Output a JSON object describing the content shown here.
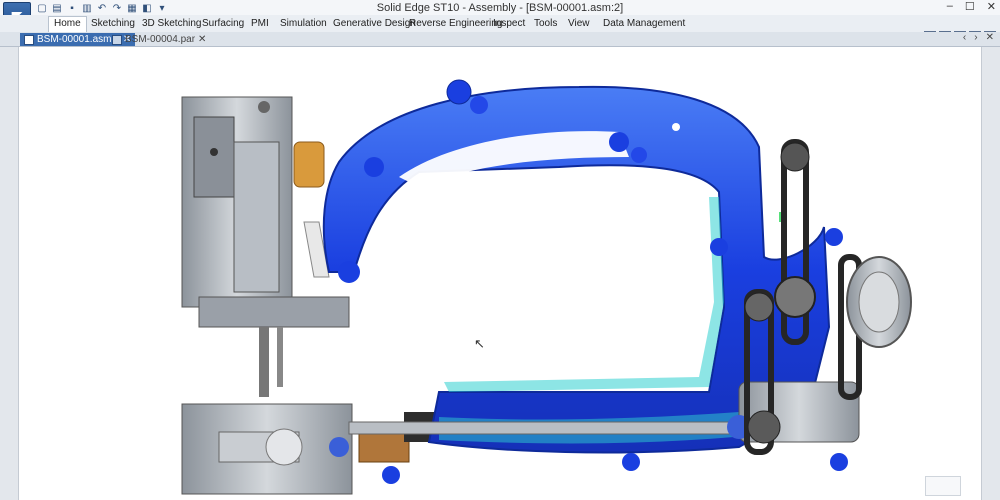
{
  "titlebar": {
    "title": "Solid Edge ST10 - Assembly - [BSM-00001.asm:2]",
    "window_controls": [
      "–",
      "☐",
      "✕"
    ]
  },
  "quick_access": [
    "new-icon",
    "open-icon",
    "save-icon",
    "print-icon",
    "undo-icon",
    "redo-icon",
    "grid-icon",
    "options-icon",
    "customize-icon"
  ],
  "ribbon": {
    "tabs": [
      "Home",
      "Sketching",
      "3D Sketching",
      "Surfacing",
      "PMI",
      "Simulation",
      "Generative Design",
      "Reverse Engineering",
      "Inspect",
      "Tools",
      "View",
      "Data Management"
    ],
    "active_tab": "Home",
    "help_icons": [
      "?",
      "▣",
      "–",
      "☐",
      "✕"
    ]
  },
  "documents": {
    "tabs": [
      {
        "label": "BSM-00001.asm:2",
        "active": true,
        "close": "✕"
      },
      {
        "label": "BSM-00004.par",
        "active": false,
        "close": "✕"
      }
    ],
    "arrows": [
      "‹",
      "›",
      "✕"
    ]
  },
  "colors": {
    "frame_blue": "#1a3fe0",
    "frame_highlight": "#4a7df5",
    "stress_cyan": "#2fd0d0",
    "stress_green": "#57e07a",
    "metal_gray": "#a6acb4",
    "bronze": "#c8803a",
    "belt_dark": "#262626"
  }
}
